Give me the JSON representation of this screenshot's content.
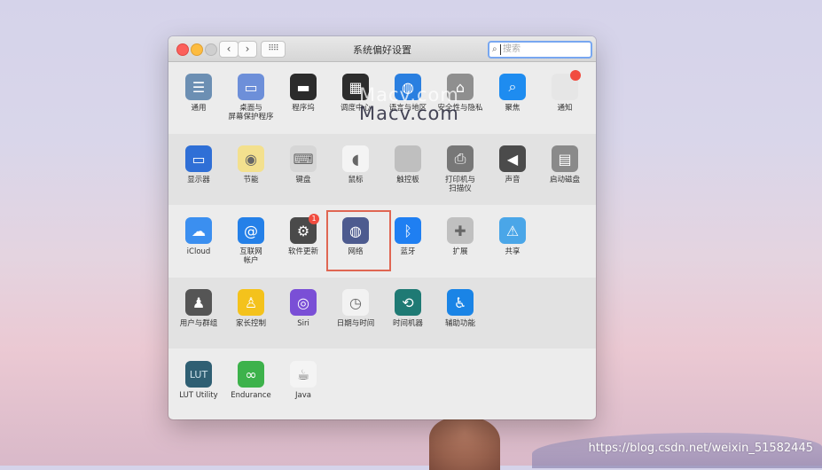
{
  "window": {
    "title": "系统偏好设置",
    "search_placeholder": "搜索"
  },
  "rows": [
    {
      "items": [
        {
          "label": "通用",
          "icon": "general-icon",
          "glyph": "☰",
          "color": "#6c8fb3"
        },
        {
          "label": "桌面与\n屏幕保护程序",
          "icon": "desktop-icon",
          "glyph": "▭",
          "color": "#6d8fd9"
        },
        {
          "label": "程序坞",
          "icon": "dock-icon",
          "glyph": "▬",
          "color": "#2b2b2b"
        },
        {
          "label": "调度中心",
          "icon": "mission-control-icon",
          "glyph": "▦",
          "color": "#2d2d2d"
        },
        {
          "label": "语言与地区",
          "icon": "language-region-icon",
          "glyph": "◍",
          "color": "#2a7fe0"
        },
        {
          "label": "安全性与隐私",
          "icon": "security-icon",
          "glyph": "⌂",
          "color": "#8f8f8f"
        },
        {
          "label": "聚焦",
          "icon": "spotlight-icon",
          "glyph": "⌕",
          "color": "#1e8cf0"
        },
        {
          "label": "通知",
          "icon": "notifications-icon",
          "glyph": "",
          "color": "#e6e6e6"
        }
      ]
    },
    {
      "items": [
        {
          "label": "显示器",
          "icon": "displays-icon",
          "glyph": "▭",
          "color": "#2f6fd6"
        },
        {
          "label": "节能",
          "icon": "energy-saver-icon",
          "glyph": "◉",
          "color": "#f3e08e"
        },
        {
          "label": "键盘",
          "icon": "keyboard-icon",
          "glyph": "⌨",
          "color": "#d6d6d6"
        },
        {
          "label": "鼠标",
          "icon": "mouse-icon",
          "glyph": "◖",
          "color": "#f4f4f4"
        },
        {
          "label": "触控板",
          "icon": "trackpad-icon",
          "glyph": "",
          "color": "#bfbfbf"
        },
        {
          "label": "打印机与\n扫描仪",
          "icon": "printer-icon",
          "glyph": "⎙",
          "color": "#777777"
        },
        {
          "label": "声音",
          "icon": "sound-icon",
          "glyph": "◀",
          "color": "#4b4b4b"
        },
        {
          "label": "启动磁盘",
          "icon": "startup-disk-icon",
          "glyph": "▤",
          "color": "#8a8a8a"
        }
      ]
    },
    {
      "items": [
        {
          "label": "iCloud",
          "icon": "icloud-icon",
          "glyph": "☁",
          "color": "#3b8ff0"
        },
        {
          "label": "互联网\n帐户",
          "icon": "internet-accounts-icon",
          "glyph": "@",
          "color": "#2480e8"
        },
        {
          "label": "软件更新",
          "icon": "software-update-icon",
          "glyph": "⚙",
          "color": "#4a4a4a",
          "badge": "1"
        },
        {
          "label": "网络",
          "icon": "network-icon",
          "glyph": "◍",
          "color": "#4d5b8f"
        },
        {
          "label": "蓝牙",
          "icon": "bluetooth-icon",
          "glyph": "ᛒ",
          "color": "#1f7ff2"
        },
        {
          "label": "扩展",
          "icon": "extensions-icon",
          "glyph": "✚",
          "color": "#c0c0c0"
        },
        {
          "label": "共享",
          "icon": "sharing-icon",
          "glyph": "⚠",
          "color": "#4aa6e8"
        }
      ]
    },
    {
      "items": [
        {
          "label": "用户与群组",
          "icon": "users-groups-icon",
          "glyph": "♟",
          "color": "#555555"
        },
        {
          "label": "家长控制",
          "icon": "parental-controls-icon",
          "glyph": "♙",
          "color": "#f4c21c"
        },
        {
          "label": "Siri",
          "icon": "siri-icon",
          "glyph": "◎",
          "color": "#7a4fd6"
        },
        {
          "label": "日期与时间",
          "icon": "date-time-icon",
          "glyph": "◷",
          "color": "#f2f2f2"
        },
        {
          "label": "时间机器",
          "icon": "time-machine-icon",
          "glyph": "⟲",
          "color": "#1f7a74"
        },
        {
          "label": "辅助功能",
          "icon": "accessibility-icon",
          "glyph": "♿",
          "color": "#1a84e6"
        }
      ]
    },
    {
      "items": [
        {
          "label": "LUT Utility",
          "icon": "lut-utility-icon",
          "glyph": "LUT",
          "color": "#2f5f73"
        },
        {
          "label": "Endurance",
          "icon": "endurance-icon",
          "glyph": "∞",
          "color": "#3db24b"
        },
        {
          "label": "Java",
          "icon": "java-icon",
          "glyph": "☕",
          "color": "#f4f4f4"
        }
      ]
    }
  ],
  "overlays": {
    "watermark_top": "Macv.com",
    "watermark_bottom": "Macv.com",
    "csdn_url": "https://blog.csdn.net/weixin_51582445"
  }
}
